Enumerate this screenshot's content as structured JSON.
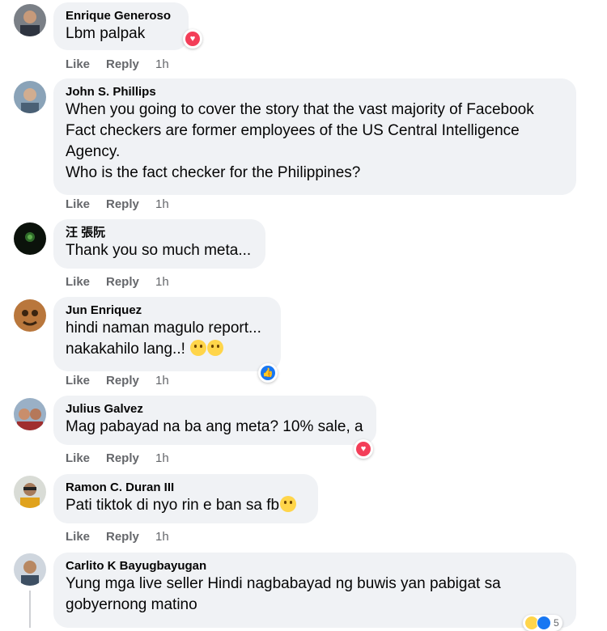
{
  "colors": {
    "bubble_bg": "#f0f2f5",
    "action_text": "#65676b",
    "love": "#f33e58",
    "like": "#1877f2"
  },
  "comments": [
    {
      "author": "Enrique Generoso",
      "text": "Lbm palpak",
      "like_label": "Like",
      "reply_label": "Reply",
      "time": "1h",
      "reaction": "love-icon"
    },
    {
      "author": "John S. Phillips",
      "text": "When you going to cover the story that the vast majority of Facebook\nFact checkers are former employees of the US Central Intelligence\nAgency.\nWho is the fact checker for the Philippines?",
      "like_label": "Like",
      "reply_label": "Reply",
      "time": "1h"
    },
    {
      "author": "汪 張阮",
      "text": "Thank you so much meta...",
      "like_label": "Like",
      "reply_label": "Reply",
      "time": "1h"
    },
    {
      "author": "Jun Enriquez",
      "text_line1": "hindi naman magulo report...",
      "text_line2": "nakakahilo lang..!",
      "like_label": "Like",
      "reply_label": "Reply",
      "time": "1h",
      "reaction": "like-icon"
    },
    {
      "author": "Julius Galvez",
      "text": "Mag pabayad na ba ang meta? 10% sale, a",
      "like_label": "Like",
      "reply_label": "Reply",
      "time": "1h",
      "reaction": "love-icon"
    },
    {
      "author": "Ramon C. Duran III",
      "text": "Pati tiktok di nyo rin e ban sa fb",
      "like_label": "Like",
      "reply_label": "Reply",
      "time": "1h"
    },
    {
      "author": "Carlito K Bayugbayugan",
      "text": "Yung mga live seller Hindi nagbabayad ng buwis yan pabigat sa\ngobyernong matino",
      "reaction_count": "5"
    }
  ]
}
